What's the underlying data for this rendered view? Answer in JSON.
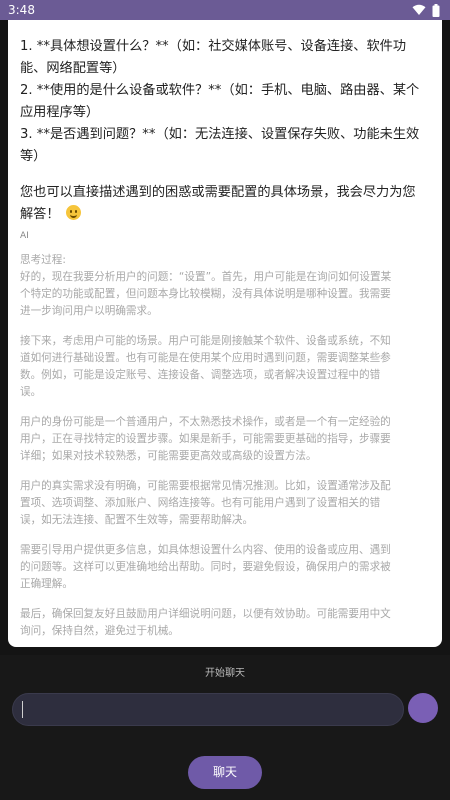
{
  "status_bar": {
    "time": "3:48",
    "icons": [
      "wifi-icon",
      "battery-icon"
    ],
    "color": "#6b5b95"
  },
  "message": {
    "lines": [
      "1. **具体想设置什么？**（如：社交媒体账号、设备连接、软件功",
      "能、网络配置等）",
      "2. **使用的是什么设备或软件？**（如：手机、电脑、路由器、某个",
      "应用程序等）",
      "3. **是否遇到问题？**（如：无法连接、设置保存失败、功能未生效",
      "等）"
    ],
    "closing_lines": [
      "您也可以直接描述遇到的困惑或需要配置的具体场景，我会尽力为您",
      "解答！"
    ],
    "emoji": "smiling-face-icon",
    "sender_label": "AI"
  },
  "thinking": {
    "title": "思考过程:",
    "paragraphs": [
      [
        "好的，现在我要分析用户的问题：“设置”。首先，用户可能是在询问如何设置某",
        "个特定的功能或配置，但问题本身比较模糊，没有具体说明是哪种设置。我需要",
        "进一步询问用户以明确需求。"
      ],
      [
        "接下来，考虑用户可能的场景。用户可能是刚接触某个软件、设备或系统，不知",
        "道如何进行基础设置。也有可能是在使用某个应用时遇到问题，需要调整某些参",
        "数。例如，可能是设定账号、连接设备、调整选项，或者解决设置过程中的错",
        "误。"
      ],
      [
        "用户的身份可能是一个普通用户，不太熟悉技术操作，或者是一个有一定经验的",
        "用户，正在寻找特定的设置步骤。如果是新手，可能需要更基础的指导，步骤要",
        "详细；如果对技术较熟悉，可能需要更高效或高级的设置方法。"
      ],
      [
        "用户的真实需求没有明确，可能需要根据常见情况推测。比如，设置通常涉及配",
        "置项、选项调整、添加账户、网络连接等。也有可能用户遇到了设置相关的错",
        "误，如无法连接、配置不生效等，需要帮助解决。"
      ],
      [
        "需要引导用户提供更多信息，如具体想设置什么内容、使用的设备或应用、遇到",
        "的问题等。这样可以更准确地给出帮助。同时，要避免假设，确保用户的需求被",
        "正确理解。"
      ],
      [
        "最后，确保回复友好且鼓励用户详细说明问题，以便有效协助。可能需要用中文",
        "询问，保持自然，避免过于机械。"
      ]
    ]
  },
  "footer": {
    "start_chat_label": "开始聊天",
    "input_value": "",
    "send_icon": "send-icon",
    "chat_button_label": "聊天",
    "accent": "#6f5aa8"
  }
}
